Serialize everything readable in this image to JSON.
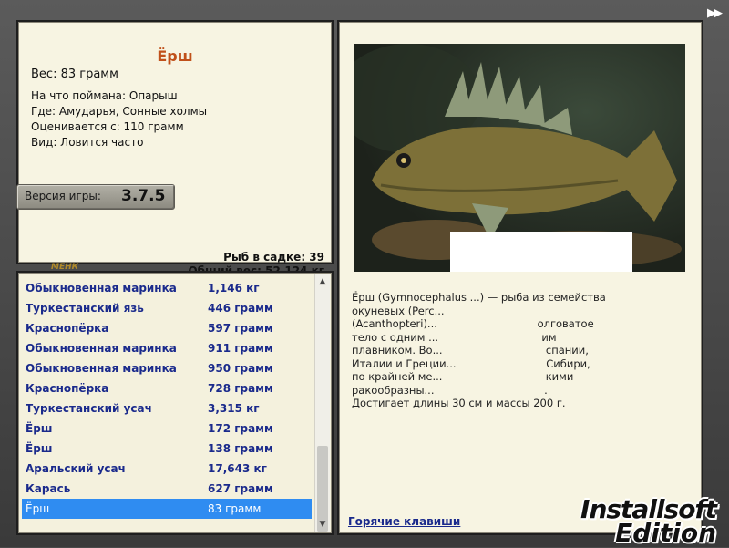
{
  "fish": {
    "title": "Ёрш",
    "weight": "Вес: 83 грамм",
    "caught_with": "На что поймана: Опарыш",
    "where": "Где: Амударья, Сонные холмы",
    "valued_from": "Оценивается с: 110 грамм",
    "kind": "Вид: Ловится часто"
  },
  "version": {
    "label": "Версия игры:",
    "number": "3.7.5"
  },
  "small_logo": "МЕНК",
  "stats": {
    "fish_in_net": "Рыб в садке: 39",
    "total_weight": "Общий вес: 52,124 кг"
  },
  "catch_list": [
    {
      "name": "Обыкновенная маринка",
      "weight": "1,146 кг"
    },
    {
      "name": "Туркестанский язь",
      "weight": "446 грамм"
    },
    {
      "name": "Краснопёрка",
      "weight": "597 грамм"
    },
    {
      "name": "Обыкновенная маринка",
      "weight": "911 грамм"
    },
    {
      "name": "Обыкновенная маринка",
      "weight": "950 грамм"
    },
    {
      "name": "Краснопёрка",
      "weight": "728 грамм"
    },
    {
      "name": "Туркестанский усач",
      "weight": "3,315 кг"
    },
    {
      "name": "Ёрш",
      "weight": "172 грамм"
    },
    {
      "name": "Ёрш",
      "weight": "138 грамм"
    },
    {
      "name": "Аральский усач",
      "weight": "17,643 кг"
    },
    {
      "name": "Карась",
      "weight": "627 грамм"
    },
    {
      "name": "Ёрш",
      "weight": "83 грамм",
      "selected": true
    }
  ],
  "description": [
    "Ёрш (Gymnocephalus ...) — рыба из семейства",
    "окуневых (Perc...",
    "(Acanthopteri)...                              олговатое",
    "тело с одним ...                               им",
    "плавником. Во...                               спании,",
    "Италии и Греции...                           Сибири,",
    "по крайней ме...                               кими",
    "ракообразны...                                 .",
    "Достигает длины 30 см и массы 200 г."
  ],
  "hotkeys_link": "Горячие клавиши",
  "watermark": {
    "line1": "Installsoft",
    "line2": "Edition"
  },
  "icons": {
    "forward": "fast-forward-icon",
    "scroll_up": "scroll-up-icon",
    "scroll_down": "scroll-down-icon"
  },
  "colors": {
    "title": "#c0501a",
    "list_text": "#1a2a8c",
    "selected_row": "#2f8cf1",
    "panel_bg": "#f7f4e2"
  }
}
